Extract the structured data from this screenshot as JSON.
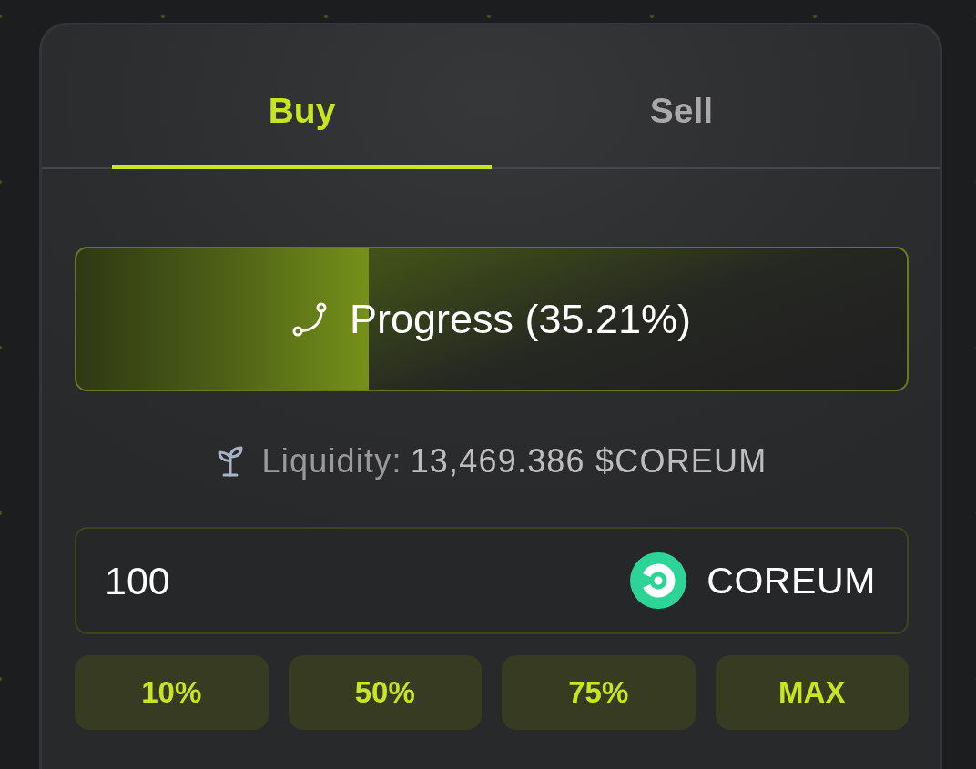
{
  "tabs": [
    {
      "label": "Buy",
      "selected": true
    },
    {
      "label": "Sell",
      "selected": false
    }
  ],
  "progress": {
    "label": "Progress (35.21%)",
    "level": 0.3521
  },
  "liquidity": {
    "label": "Liquidity:",
    "value": "13,469.386 $COREUM"
  },
  "amount_input": {
    "value": "100",
    "token": "COREUM"
  },
  "quick_amounts": [
    "10%",
    "50%",
    "75%",
    "MAX"
  ]
}
